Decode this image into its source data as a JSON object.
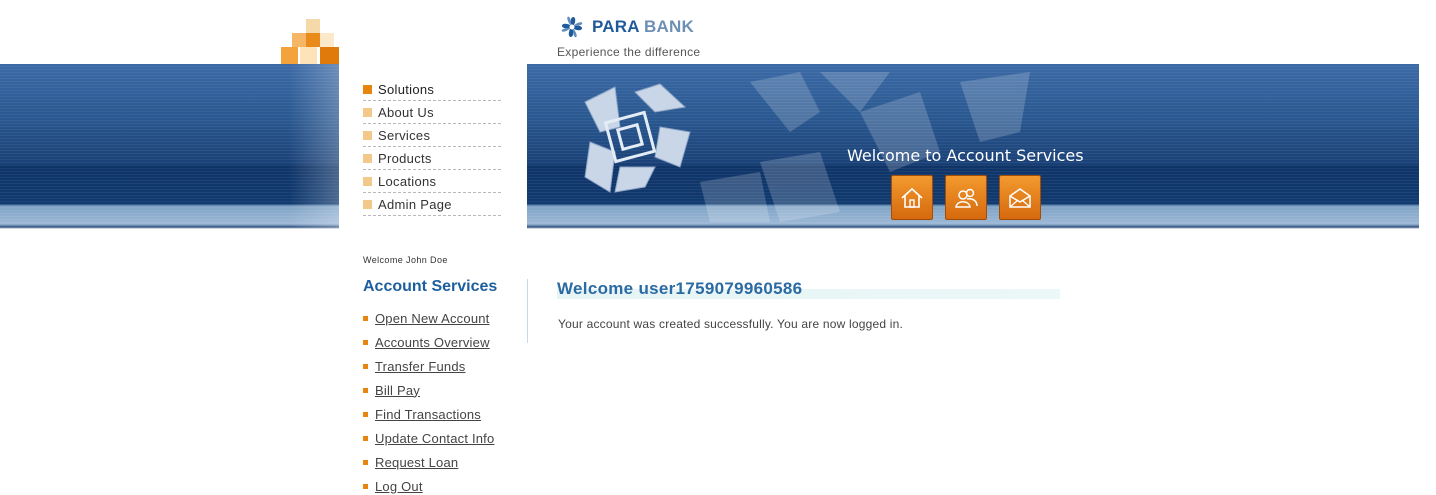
{
  "header": {
    "brand_para": "PARA",
    "brand_bank": "BANK",
    "tagline": "Experience the difference",
    "title": "Welcome to Account Services",
    "buttons": [
      {
        "icon": "home-icon"
      },
      {
        "icon": "contact-people-icon"
      },
      {
        "icon": "mail-icon"
      }
    ]
  },
  "menu": {
    "items": [
      {
        "label": "Solutions",
        "active": true
      },
      {
        "label": "About Us"
      },
      {
        "label": "Services"
      },
      {
        "label": "Products"
      },
      {
        "label": "Locations"
      },
      {
        "label": "Admin Page"
      }
    ]
  },
  "sidebar": {
    "welcome": "Welcome John Doe",
    "title": "Account Services",
    "links": [
      "Open New Account",
      "Accounts Overview",
      "Transfer Funds",
      "Bill Pay",
      "Find Transactions",
      "Update Contact Info",
      "Request Loan",
      "Log Out"
    ]
  },
  "main": {
    "title": "Welcome user1759079960586",
    "message": "Your account was created successfully. You are now logged in."
  },
  "colors": {
    "brand_blue": "#1f5b9b",
    "accent_orange": "#e8850f",
    "link_gray": "#444444"
  }
}
